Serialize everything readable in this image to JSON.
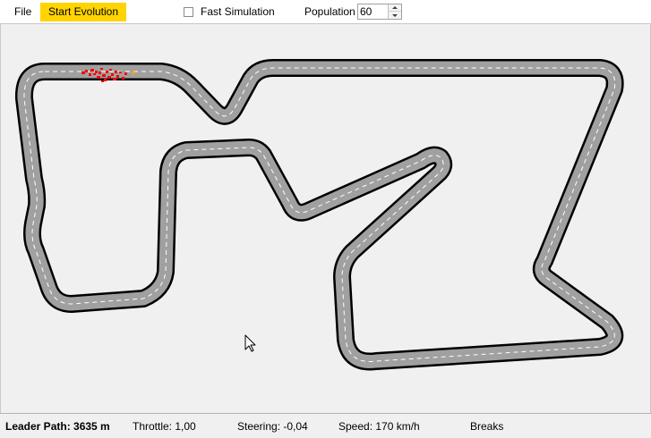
{
  "toolbar": {
    "file_label": "File",
    "start_label": "Start Evolution",
    "fast_sim_label": "Fast Simulation",
    "fast_sim_checked": false,
    "population_label": "Population",
    "population_value": "60"
  },
  "colors": {
    "start_button": "#ffd400",
    "track_asphalt": "#a0a0a0",
    "track_border": "#000000",
    "lane_marking": "#ffffff",
    "car": "#ff0000",
    "leader_car": "#ffa500"
  },
  "status": {
    "leader_path": "Leader Path: 3635 m",
    "throttle": "Throttle: 1,00",
    "steering": "Steering: -0,04",
    "speed": "Speed: 170 km/h",
    "breaks": "Breaks"
  }
}
